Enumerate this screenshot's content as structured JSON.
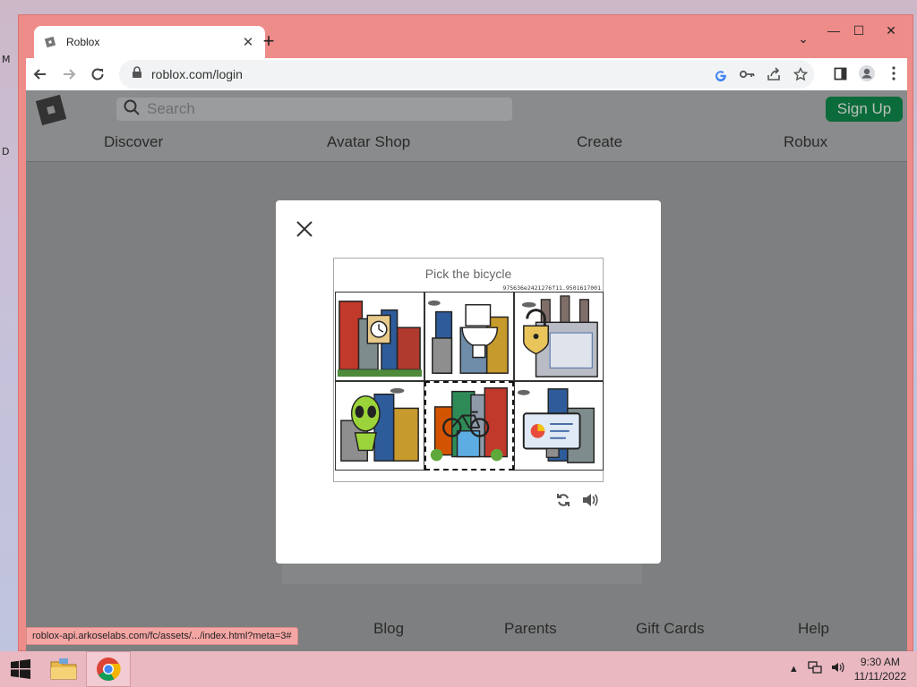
{
  "desktop": {
    "left_letters": [
      "M",
      "D"
    ]
  },
  "browser": {
    "tab_title": "Roblox",
    "tab_close": "✕",
    "new_tab": "+",
    "tab_menu": "⌄",
    "window_controls": {
      "minimize": "—",
      "maximize": "☐",
      "close": "✕"
    },
    "url": "roblox.com/login"
  },
  "roblox": {
    "search_placeholder": "Search",
    "signup_label": "Sign Up",
    "nav": [
      "Discover",
      "Avatar Shop",
      "Create",
      "Robux"
    ],
    "footer": [
      "Blog",
      "Parents",
      "Gift Cards",
      "Help"
    ]
  },
  "captcha": {
    "prompt": "Pick the bicycle",
    "challenge_id": "975636e2421276f11.9501617001",
    "tiles": [
      {
        "subject": "clock-over-buildings",
        "selected": false
      },
      {
        "subject": "toilet-over-buildings",
        "selected": false
      },
      {
        "subject": "padlock-over-buildings",
        "selected": false
      },
      {
        "subject": "alien-over-buildings",
        "selected": false
      },
      {
        "subject": "bicycle-over-buildings",
        "selected": true
      },
      {
        "subject": "monitor-over-buildings",
        "selected": false
      }
    ]
  },
  "status_bar": {
    "url": "roblox-api.arkoselabs.com/fc/assets/.../index.html?meta=3#"
  },
  "taskbar": {
    "time": "9:30 AM",
    "date": "11/11/2022"
  },
  "colors": {
    "window_frame": "#ee8c8a",
    "signup_bg": "#0b6b3a",
    "page_overlay": "#7e7f80"
  }
}
